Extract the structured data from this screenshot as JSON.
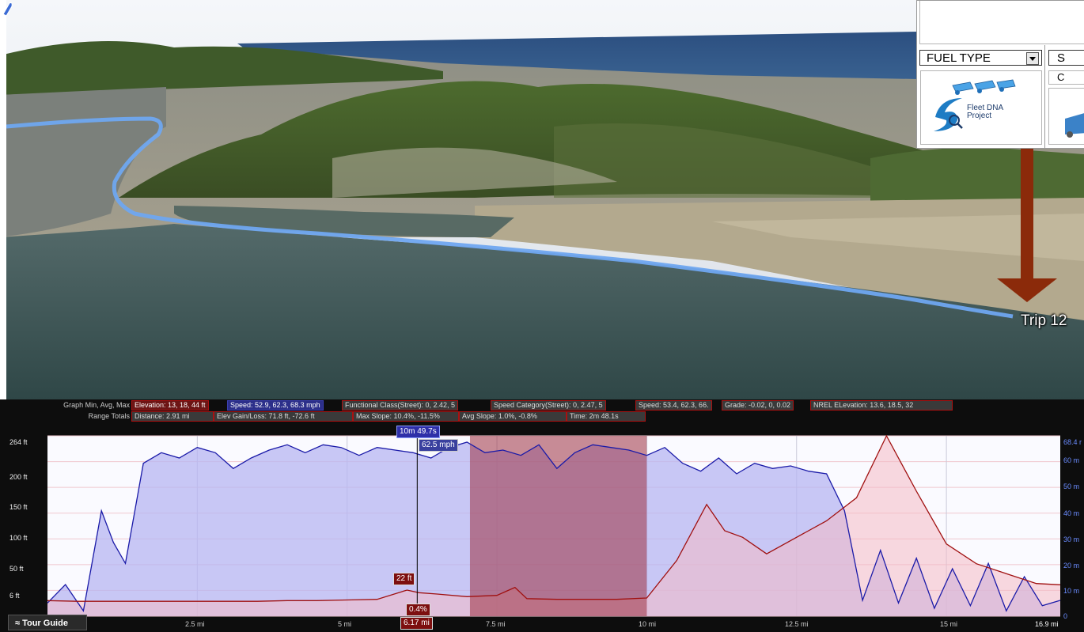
{
  "map": {
    "trip_label": "Trip 12"
  },
  "panel": {
    "fuel_type": "FUEL TYPE",
    "select2": "S",
    "c_cell": "C",
    "logo_line1": "Fleet DNA",
    "logo_line2": "Project"
  },
  "stats": {
    "graph_label": "Graph  Min, Avg, Max",
    "range_label": "Range Totals",
    "elevation": "Elevation: 13, 18, 44 ft",
    "speed": "Speed: 52.9, 62.3, 68.3 mph",
    "functional_class": "Functional Class(Street): 0, 2.42, 5",
    "speed_category": "Speed Category(Street): 0, 2.47, 5",
    "speed2": "Speed: 53.4, 62.3, 66.",
    "grade": "Grade: -0.02, 0, 0.02",
    "nrel_elevation": "NREL ELevation: 13.6, 18.5, 32",
    "distance": "Distance: 2.91 mi",
    "elev_gain": "Elev Gain/Loss: 71.8 ft, -72.6 ft",
    "max_slope": "Max Slope: 10.4%, -11.5%",
    "avg_slope": "Avg Slope: 1.0%, -0.8%",
    "time": "Time: 2m 48.1s"
  },
  "chart_data": {
    "type": "area",
    "y_left_ticks": [
      "264 ft",
      "200 ft",
      "150 ft",
      "100 ft",
      "50 ft",
      "6 ft"
    ],
    "y_right_ticks": [
      "68.4 r",
      "60 m",
      "50 m",
      "40 m",
      "30 m",
      "20 m",
      "10 m",
      "0"
    ],
    "x_ticks": [
      "2.5 mi",
      "5 mi",
      "7.5 mi",
      "10 mi",
      "12.5 mi",
      "15 mi",
      "16.9 mi"
    ],
    "xlim": [
      0,
      16.9
    ],
    "series": [
      {
        "name": "Speed",
        "color": "#1a1aa8",
        "x": [
          0,
          0.3,
          0.6,
          0.9,
          1.1,
          1.3,
          1.6,
          1.9,
          2.2,
          2.5,
          2.8,
          3.1,
          3.4,
          3.7,
          4.0,
          4.3,
          4.6,
          4.9,
          5.2,
          5.5,
          5.8,
          6.1,
          6.4,
          6.7,
          7.0,
          7.3,
          7.6,
          7.9,
          8.2,
          8.5,
          8.8,
          9.1,
          9.4,
          9.7,
          10.0,
          10.3,
          10.6,
          10.9,
          11.2,
          11.5,
          11.8,
          12.1,
          12.4,
          12.7,
          13.0,
          13.3,
          13.6,
          13.9,
          14.2,
          14.5,
          14.8,
          15.1,
          15.4,
          15.7,
          16.0,
          16.3,
          16.6,
          16.9
        ],
        "values": [
          5,
          12,
          2,
          40,
          28,
          20,
          58,
          62,
          60,
          64,
          62,
          56,
          60,
          63,
          65,
          62,
          65,
          64,
          61,
          64,
          63,
          62,
          60,
          64,
          66,
          62,
          63,
          61,
          65,
          56,
          62,
          65,
          64,
          63,
          61,
          64,
          58,
          55,
          60,
          54,
          58,
          56,
          57,
          55,
          54,
          40,
          6,
          25,
          5,
          22,
          3,
          18,
          4,
          20,
          2,
          15,
          4,
          6
        ]
      },
      {
        "name": "Elevation",
        "color": "#a01010",
        "x": [
          0,
          0.5,
          1.0,
          1.5,
          2.0,
          2.5,
          3.0,
          3.5,
          4.0,
          4.5,
          5.0,
          5.5,
          6.0,
          6.2,
          6.5,
          7.0,
          7.5,
          7.8,
          8.0,
          8.5,
          9.0,
          9.5,
          10.0,
          10.5,
          11.0,
          11.3,
          11.6,
          12.0,
          12.5,
          13.0,
          13.5,
          14.0,
          14.5,
          15.0,
          15.5,
          16.0,
          16.5,
          16.9
        ],
        "values": [
          14,
          13,
          13,
          13,
          13,
          13,
          13,
          13,
          14,
          14,
          15,
          16,
          30,
          26,
          24,
          20,
          22,
          34,
          17,
          16,
          16,
          16,
          18,
          75,
          160,
          120,
          110,
          85,
          110,
          135,
          170,
          264,
          180,
          100,
          70,
          55,
          40,
          38
        ]
      }
    ],
    "selection_range": [
      7.05,
      10.0
    ],
    "cursor": {
      "x": 6.17
    }
  },
  "chart_labels": {
    "cursor_time": "10m 49.7s",
    "cursor_speed": "62.5 mph",
    "cursor_elev": "22 ft",
    "cursor_slope": "0.4%",
    "cursor_dist": "6.17 mi"
  },
  "tour_guide": "≈ Tour Guide"
}
